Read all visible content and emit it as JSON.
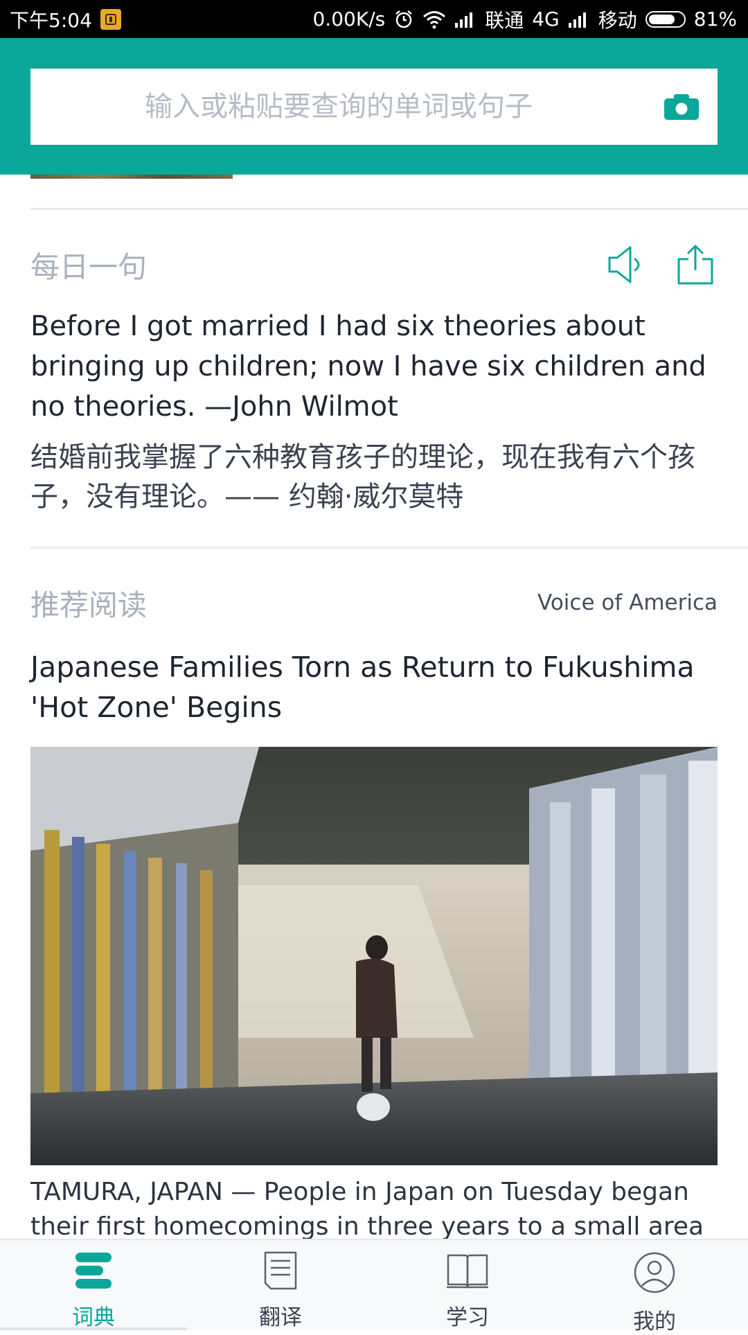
{
  "status_bar": {
    "time": "下午5:04",
    "notification_icon": "app-notification-icon",
    "speed": "0.00K/s",
    "carrier1": "联通",
    "network1": "4G",
    "carrier2": "移动",
    "battery": "81%",
    "battery_level": 0.81
  },
  "search": {
    "placeholder": "输入或粘贴要查询的单词或句子",
    "camera_icon": "camera-icon"
  },
  "daily": {
    "title": "每日一句",
    "sentence_en": "Before I got married I had six theories about bringing up children; now I have six children and no theories. —John Wilmot",
    "sentence_zh": "结婚前我掌握了六种教育孩子的理论，现在我有六个孩子，没有理论。—— 约翰·威尔莫特",
    "speaker_icon": "speaker-icon",
    "share_icon": "share-icon"
  },
  "reading": {
    "title": "推荐阅读",
    "source": "Voice of America",
    "article_title": "Japanese Families Torn as Return to Fukushima 'Hot Zone' Begins",
    "summary": "TAMURA, JAPAN — People in Japan on Tuesday began their first homecomings in three years to a small area"
  },
  "nav": {
    "items": [
      {
        "label": "词典",
        "icon": "dictionary-icon",
        "active": true
      },
      {
        "label": "翻译",
        "icon": "translate-icon",
        "active": false
      },
      {
        "label": "学习",
        "icon": "book-icon",
        "active": false
      },
      {
        "label": "我的",
        "icon": "profile-icon",
        "active": false
      }
    ]
  },
  "colors": {
    "accent": "#0aa79a",
    "muted": "#a9b1bd",
    "text": "#1e2530"
  }
}
